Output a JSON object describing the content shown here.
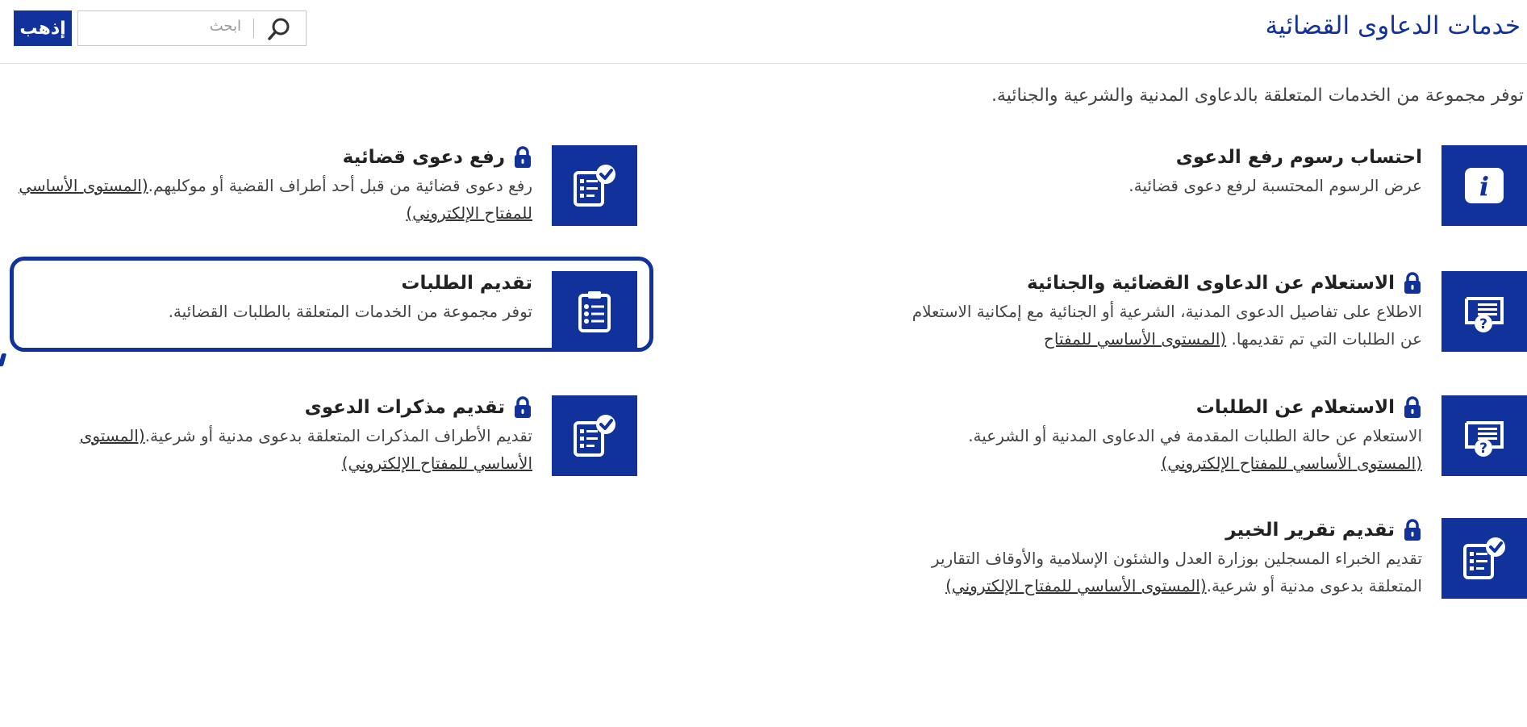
{
  "header": {
    "title": "خدمات الدعاوى القضائية",
    "search_placeholder": "ابحث",
    "go_label": "إذهب"
  },
  "intro": "توفر مجموعة من الخدمات المتعلقة بالدعاوى المدنية والشرعية والجنائية.",
  "cards": [
    {
      "title": "احتساب رسوم رفع الدعوى",
      "desc": "عرض الرسوم المحتسبة لرفع دعوى قضائية.",
      "link": "",
      "icon": "info-icon",
      "locked": false
    },
    {
      "title": "رفع دعوى قضائية",
      "desc": "رفع دعوى قضائية من قبل أحد أطراف القضية أو موكليهم.",
      "link": "(المستوى الأساسي للمفتاح الإلكتروني)",
      "icon": "checklist-approve-icon",
      "locked": true
    },
    {
      "title": "الاستعلام عن الدعاوى القضائية والجنائية",
      "desc": "الاطلاع على تفاصيل الدعوى المدنية، الشرعية أو الجنائية مع إمكانية الاستعلام عن الطلبات التي تم تقديمها. ",
      "link": "(المستوى الأساسي للمفتاح",
      "icon": "inquiry-screen-icon",
      "locked": true
    },
    {
      "title": "تقديم الطلبات",
      "desc": "توفر مجموعة من الخدمات المتعلقة بالطلبات القضائية.",
      "link": "",
      "icon": "clipboard-list-icon",
      "locked": false
    },
    {
      "title": "الاستعلام عن الطلبات",
      "desc": "الاستعلام عن حالة الطلبات المقدمة في الدعاوى المدنية أو الشرعية.",
      "link": "(المستوى الأساسي للمفتاح الإلكتروني)",
      "icon": "inquiry-screen-icon",
      "locked": true
    },
    {
      "title": "تقديم مذكرات الدعوى",
      "desc": "تقديم الأطراف المذكرات المتعلقة بدعوى مدنية أو شرعية.",
      "link": "(المستوى الأساسي للمفتاح الإلكتروني)",
      "icon": "checklist-approve-icon",
      "locked": true
    },
    {
      "title": "تقديم تقرير الخبير",
      "desc": "تقديم الخبراء المسجلين بوزارة العدل والشئون الإسلامية والأوقاف التقارير المتعلقة بدعوى مدنية أو شرعية.",
      "link": "(المستوى الأساسي للمفتاح الإلكتروني)",
      "icon": "checklist-approve-icon",
      "locked": true
    }
  ],
  "colors": {
    "brand": "#12329b"
  }
}
